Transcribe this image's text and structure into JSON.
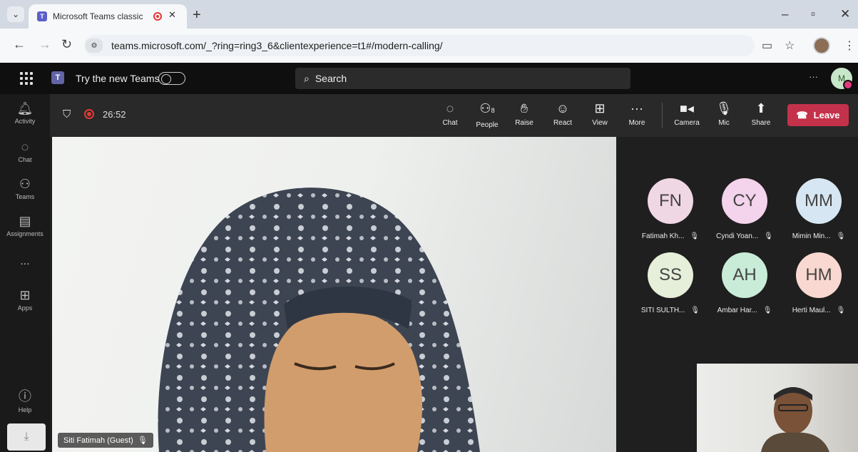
{
  "browser": {
    "tab_title": "Microsoft Teams classic",
    "url": "teams.microsoft.com/_?ring=ring3_6&clientexperience=t1#/modern-calling/"
  },
  "teams": {
    "try_new_label": "Try the new Teams",
    "search_label": "Search",
    "user_initial": "M"
  },
  "rail": [
    {
      "label": "Activity",
      "icon": "bell-icon"
    },
    {
      "label": "Chat",
      "icon": "chat-icon"
    },
    {
      "label": "Teams",
      "icon": "teams-icon"
    },
    {
      "label": "Assignments",
      "icon": "assignments-icon"
    },
    {
      "label": "...",
      "icon": "more-icon"
    },
    {
      "label": "Apps",
      "icon": "apps-icon"
    },
    {
      "label": "Help",
      "icon": "help-icon"
    }
  ],
  "meeting": {
    "timer": "26:52",
    "people_count": "8",
    "controls": {
      "chat": "Chat",
      "people": "People",
      "raise": "Raise",
      "react": "React",
      "view": "View",
      "more": "More",
      "camera": "Camera",
      "mic": "Mic",
      "share": "Share",
      "leave": "Leave"
    },
    "main_speaker": "Siti Fatimah (Guest)",
    "participants": [
      {
        "initials": "FN",
        "name": "Fatimah Kh...",
        "color": "#f0d7e4"
      },
      {
        "initials": "CY",
        "name": "Cyndi Yoan...",
        "color": "#f4d3ec"
      },
      {
        "initials": "MM",
        "name": "Mimin Min...",
        "color": "#d6e6f2"
      },
      {
        "initials": "SS",
        "name": "SITI SULTH...",
        "color": "#e6efd9"
      },
      {
        "initials": "AH",
        "name": "Ambar Har...",
        "color": "#c9ecd9"
      },
      {
        "initials": "HM",
        "name": "Herti Maul...",
        "color": "#f8d8d0"
      }
    ]
  }
}
